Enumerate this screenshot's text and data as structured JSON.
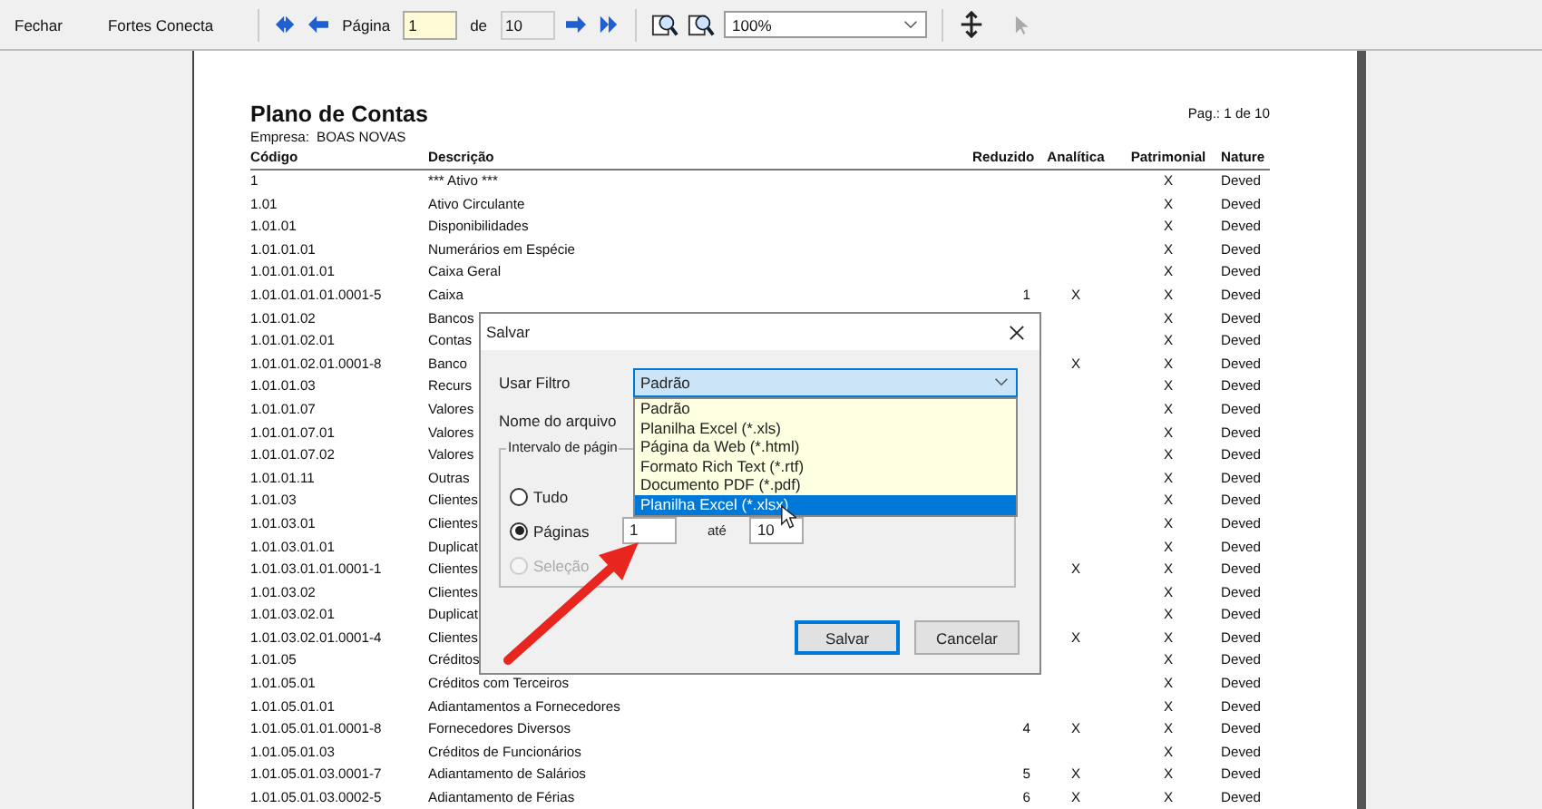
{
  "toolbar": {
    "buttons": [
      "Fechar",
      "Fortes Conecta"
    ],
    "page_label": "Página",
    "page_value": "1",
    "of_label": "de",
    "page_count": "10",
    "zoom": "100%"
  },
  "report": {
    "title": "Plano de Contas",
    "page_info": "Pag.: 1 de 10",
    "company_label": "Empresa:",
    "company": "BOAS NOVAS",
    "columns": [
      "Código",
      "Descrição",
      "Reduzido",
      "Analítica",
      "Patrimonial",
      "Nature"
    ],
    "rows": [
      {
        "code": "1",
        "description": "*** Ativo ***",
        "patrimonial": "X",
        "nature": "Deved"
      },
      {
        "code": "1.01",
        "description": "Ativo Circulante",
        "patrimonial": "X",
        "nature": "Deved"
      },
      {
        "code": "1.01.01",
        "description": "Disponibilidades",
        "patrimonial": "X",
        "nature": "Deved"
      },
      {
        "code": "1.01.01.01",
        "description": "Numerários em Espécie",
        "patrimonial": "X",
        "nature": "Deved"
      },
      {
        "code": "1.01.01.01.01",
        "description": "Caixa Geral",
        "patrimonial": "X",
        "nature": "Deved"
      },
      {
        "code": "1.01.01.01.01.0001-5",
        "description": "Caixa",
        "reduced": "1",
        "analytic": "X",
        "patrimonial": "X",
        "nature": "Deved"
      },
      {
        "code": "1.01.01.02",
        "description": "Bancos",
        "patrimonial": "X",
        "nature": "Deved"
      },
      {
        "code": "1.01.01.02.01",
        "description": "Contas",
        "patrimonial": "X",
        "nature": "Deved"
      },
      {
        "code": "1.01.01.02.01.0001-8",
        "description": "Banco",
        "analytic": "X",
        "patrimonial": "X",
        "nature": "Deved"
      },
      {
        "code": "1.01.01.03",
        "description": "Recurs",
        "patrimonial": "X",
        "nature": "Deved"
      },
      {
        "code": "1.01.01.07",
        "description": "Valores",
        "patrimonial": "X",
        "nature": "Deved"
      },
      {
        "code": "1.01.01.07.01",
        "description": "Valores",
        "patrimonial": "X",
        "nature": "Deved"
      },
      {
        "code": "1.01.01.07.02",
        "description": "Valores",
        "patrimonial": "X",
        "nature": "Deved"
      },
      {
        "code": "1.01.01.11",
        "description": "Outras",
        "patrimonial": "X",
        "nature": "Deved"
      },
      {
        "code": "1.01.03",
        "description": "Clientes",
        "patrimonial": "X",
        "nature": "Deved"
      },
      {
        "code": "1.01.03.01",
        "description": "Clientes",
        "patrimonial": "X",
        "nature": "Deved"
      },
      {
        "code": "1.01.03.01.01",
        "description": "Duplicat",
        "patrimonial": "X",
        "nature": "Deved"
      },
      {
        "code": "1.01.03.01.01.0001-1",
        "description": "Clientes",
        "analytic": "X",
        "patrimonial": "X",
        "nature": "Deved"
      },
      {
        "code": "1.01.03.02",
        "description": "Clientes",
        "patrimonial": "X",
        "nature": "Deved"
      },
      {
        "code": "1.01.03.02.01",
        "description": "Duplicat",
        "patrimonial": "X",
        "nature": "Deved"
      },
      {
        "code": "1.01.03.02.01.0001-4",
        "description": "Clientes",
        "analytic": "X",
        "patrimonial": "X",
        "nature": "Deved"
      },
      {
        "code": "1.01.05",
        "description": "Créditos",
        "patrimonial": "X",
        "nature": "Deved"
      },
      {
        "code": "1.01.05.01",
        "description": "Créditos com Terceiros",
        "patrimonial": "X",
        "nature": "Deved"
      },
      {
        "code": "1.01.05.01.01",
        "description": "Adiantamentos a Fornecedores",
        "patrimonial": "X",
        "nature": "Deved"
      },
      {
        "code": "1.01.05.01.01.0001-8",
        "description": "Fornecedores Diversos",
        "reduced": "4",
        "analytic": "X",
        "patrimonial": "X",
        "nature": "Deved"
      },
      {
        "code": "1.01.05.01.03",
        "description": "Créditos de Funcionários",
        "patrimonial": "X",
        "nature": "Deved"
      },
      {
        "code": "1.01.05.01.03.0001-7",
        "description": "Adiantamento de Salários",
        "reduced": "5",
        "analytic": "X",
        "patrimonial": "X",
        "nature": "Deved"
      },
      {
        "code": "1.01.05.01.03.0002-5",
        "description": "Adiantamento de Férias",
        "reduced": "6",
        "analytic": "X",
        "patrimonial": "X",
        "nature": "Deved"
      }
    ]
  },
  "dialog": {
    "title": "Salvar",
    "filter_label": "Usar Filtro",
    "filter_value": "Padrão",
    "filter_options": [
      {
        "label": "Padrão",
        "selected": false
      },
      {
        "label": "Planilha Excel (*.xls)",
        "selected": false
      },
      {
        "label": "Página da Web (*.html)",
        "selected": false
      },
      {
        "label": "Formato Rich Text (*.rtf)",
        "selected": false
      },
      {
        "label": "Documento PDF (*.pdf)",
        "selected": false
      },
      {
        "label": "Planilha Excel (*.xlsx)",
        "selected": true
      }
    ],
    "filename_label": "Nome do arquivo",
    "range_label": "Intervalo de págin",
    "radios": [
      {
        "label": "Tudo",
        "selected": false,
        "disabled": false
      },
      {
        "label": "Páginas",
        "selected": true,
        "disabled": false
      },
      {
        "label": "Seleção",
        "selected": false,
        "disabled": true
      }
    ],
    "from_value": "1",
    "to_label": "até",
    "to_value": "10",
    "buttons": [
      {
        "label": "Salvar",
        "default": true
      },
      {
        "label": "Cancelar",
        "default": false
      }
    ]
  }
}
